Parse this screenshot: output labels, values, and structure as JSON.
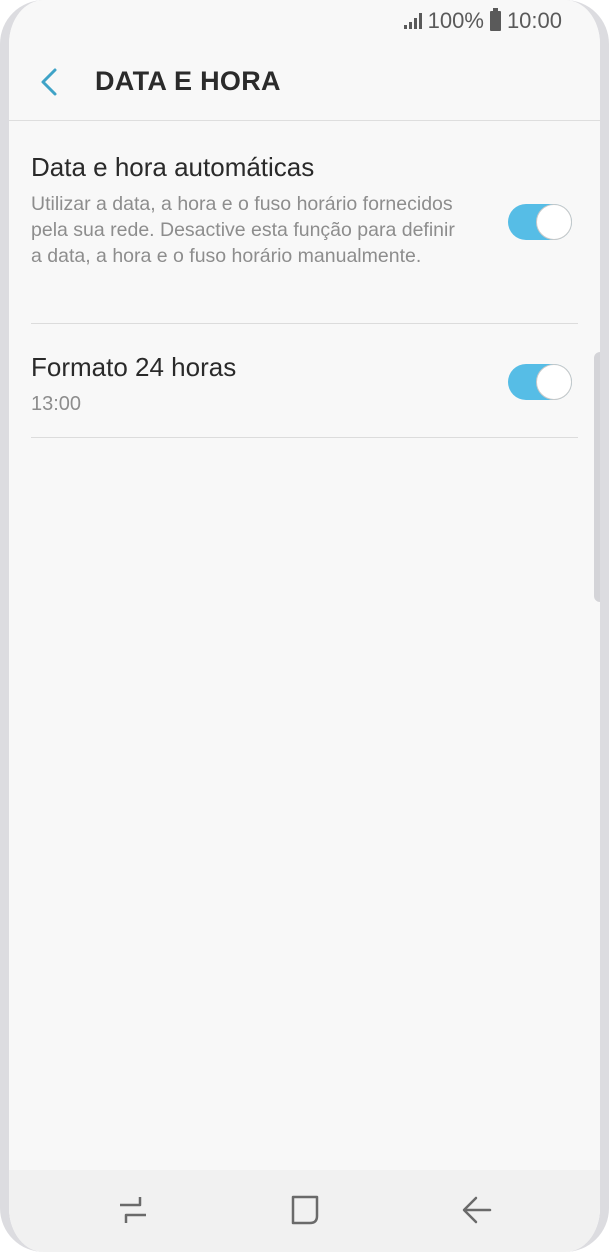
{
  "status_bar": {
    "battery_text": "100%",
    "time": "10:00",
    "icons": [
      "signal-icon",
      "battery-icon"
    ]
  },
  "header": {
    "title": "DATA E HORA",
    "back_icon": "chevron-left-icon"
  },
  "settings": [
    {
      "title": "Data e hora automáticas",
      "description": "Utilizar a data, a hora e o fuso horário fornecidos pela sua rede. Desactive esta função para definir a data, a hora e o fuso horário manualmente.",
      "toggle_on": true
    },
    {
      "title": "Formato 24 horas",
      "subtitle": "13:00",
      "toggle_on": true
    }
  ],
  "nav_bar": {
    "icons": [
      "recent-apps-icon",
      "home-icon",
      "back-arrow-icon"
    ]
  },
  "colors": {
    "accent": "#56bde6",
    "back_icon": "#3fa3c7",
    "background": "#f8f8f8"
  }
}
